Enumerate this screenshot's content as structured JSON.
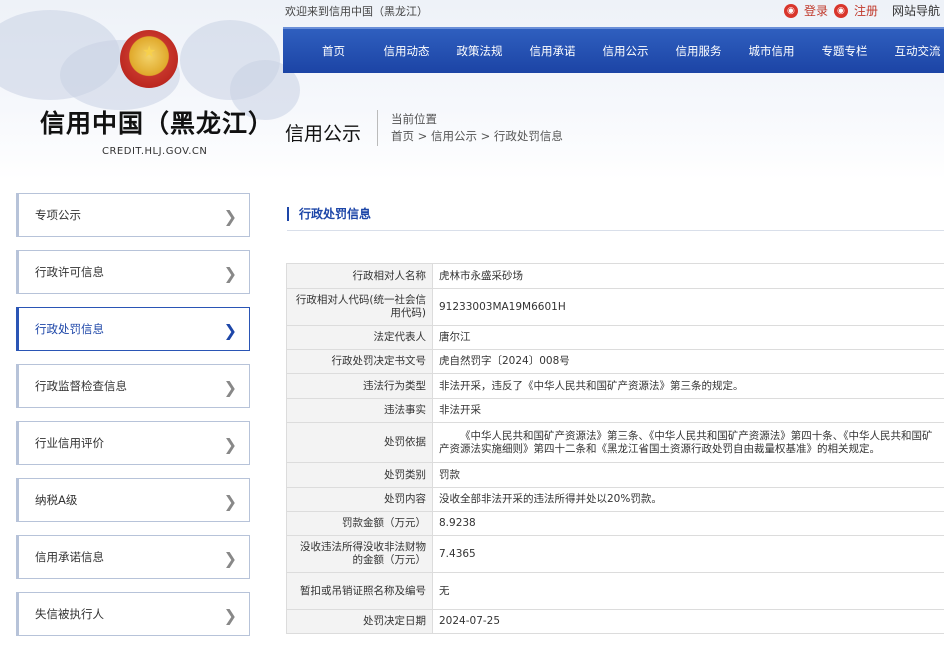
{
  "topbar": {
    "welcome": "欢迎来到信用中国（黑龙江）",
    "login": "登录",
    "register": "注册",
    "site_nav": "网站导航"
  },
  "nav": {
    "items": [
      "首页",
      "信用动态",
      "政策法规",
      "信用承诺",
      "信用公示",
      "信用服务",
      "城市信用",
      "专题专栏",
      "互动交流"
    ]
  },
  "site": {
    "title": "信用中国（黑龙江）",
    "url": "CREDIT.HLJ.GOV.CN"
  },
  "page": {
    "section_title": "信用公示",
    "crumb_label": "当前位置",
    "breadcrumb": "首页 > 信用公示 > 行政处罚信息"
  },
  "sidebar": {
    "items": [
      {
        "label": "专项公示",
        "active": false
      },
      {
        "label": "行政许可信息",
        "active": false
      },
      {
        "label": "行政处罚信息",
        "active": true
      },
      {
        "label": "行政监督检查信息",
        "active": false
      },
      {
        "label": "行业信用评价",
        "active": false
      },
      {
        "label": "纳税A级",
        "active": false
      },
      {
        "label": "信用承诺信息",
        "active": false
      },
      {
        "label": "失信被执行人",
        "active": false
      }
    ]
  },
  "content": {
    "title": "行政处罚信息",
    "rows": [
      {
        "key": "行政相对人名称",
        "value": "虎林市永盛采砂场"
      },
      {
        "key": "行政相对人代码(统一社会信用代码)",
        "value": "91233003MA19M6601H"
      },
      {
        "key": "法定代表人",
        "value": "唐尔江"
      },
      {
        "key": "行政处罚决定书文号",
        "value": "虎自然罚字〔2024〕008号"
      },
      {
        "key": "违法行为类型",
        "value": "非法开采，违反了《中华人民共和国矿产资源法》第三条的规定。"
      },
      {
        "key": "违法事实",
        "value": "非法开采"
      },
      {
        "key": "处罚依据",
        "value": "《中华人民共和国矿产资源法》第三条、《中华人民共和国矿产资源法》第四十条、《中华人民共和国矿产资源法实施细则》第四十二条和《黑龙江省国土资源行政处罚自由裁量权基准》的相关规定。"
      },
      {
        "key": "处罚类别",
        "value": "罚款"
      },
      {
        "key": "处罚内容",
        "value": "没收全部非法开采的违法所得并处以20%罚款。"
      },
      {
        "key": "罚款金额（万元）",
        "value": "8.9238"
      },
      {
        "key": "没收违法所得没收非法财物的金额（万元）",
        "value": "7.4365"
      },
      {
        "key": "暂扣或吊销证照名称及编号",
        "value": "无"
      },
      {
        "key": "处罚决定日期",
        "value": "2024-07-25"
      }
    ]
  },
  "icons": {
    "login": "user-icon",
    "register": "register-icon",
    "chevron": "chevron-right-icon"
  },
  "colors": {
    "nav": "#1c44a5",
    "accent": "#1d46a8",
    "login": "#d9352b"
  }
}
